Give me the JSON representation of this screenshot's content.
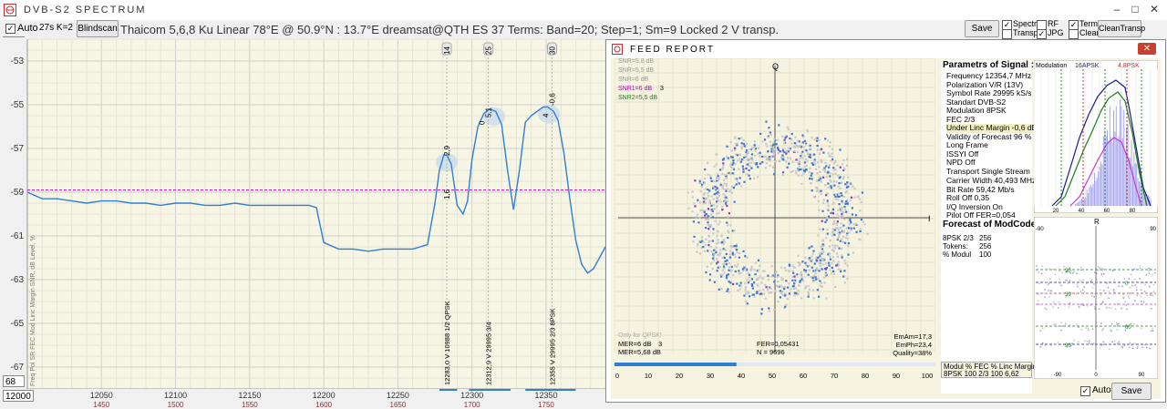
{
  "app": {
    "title": "DVB-S2   SPECTRUM"
  },
  "toolbar": {
    "freq_start": "51",
    "auto_label": "Auto",
    "auto_checked": true,
    "auto_params": "27s K=2",
    "blindscan_label": "Blindscan",
    "sat_info": "Thaicom 5,6,8 Ku Linear   78°E  @  50.9°N : 13.7°E    dreamsat@QTH ES 37     Terms:  Band=20; Step=1; Sm=9    Locked  2 V transp.",
    "save_label": "Save",
    "options": [
      {
        "label": "Spectr",
        "checked": true
      },
      {
        "label": "RF",
        "checked": false
      },
      {
        "label": "Terms",
        "checked": true
      },
      {
        "label": "Transp.",
        "checked": false
      },
      {
        "label": "JPG",
        "checked": true
      },
      {
        "label": "Clean",
        "checked": false
      }
    ],
    "clean_transp_label": "CleanTransp"
  },
  "spectrum": {
    "y_axis_labels": [
      "-53",
      "-55",
      "-57",
      "-59",
      "-61",
      "-63",
      "-65",
      "-67"
    ],
    "left_text": "Freq  Pol  SR  FEC  Mod                    Linc Margin    SNR, dB    Level, %",
    "freq_input": "12000",
    "level_input": "68",
    "x_axis_labels": [
      "12050",
      "12100",
      "12150",
      "12200",
      "12250",
      "12300",
      "12350"
    ],
    "x_axis_sub_labels": [
      "1450",
      "1500",
      "1550",
      "1600",
      "1650",
      "1700",
      "1750"
    ],
    "markers": [
      {
        "num": "14",
        "snr": "2,9",
        "margin": "1,6",
        "label": "12283,0  V  10988  1/2  QPSK"
      },
      {
        "num": "25",
        "snr": "5,1",
        "margin": "0",
        "label": "12312,9  V  29995  3/4"
      },
      {
        "num": "30",
        "snr": "-0,6",
        "margin": "4",
        "label": "12355  V  29995  2/3  8PSK"
      }
    ],
    "chart_data": {
      "type": "line",
      "xlabel": "",
      "ylabel": "",
      "x_range": [
        12000,
        12390
      ],
      "y_range": [
        -68,
        -52
      ],
      "threshold_level": -58.9,
      "x": [
        12000,
        12010,
        12020,
        12030,
        12040,
        12050,
        12060,
        12070,
        12080,
        12090,
        12100,
        12110,
        12120,
        12130,
        12140,
        12150,
        12160,
        12170,
        12180,
        12190,
        12195,
        12200,
        12210,
        12220,
        12230,
        12240,
        12250,
        12260,
        12270,
        12275,
        12278,
        12281,
        12283,
        12286,
        12290,
        12294,
        12297,
        12300,
        12304,
        12308,
        12312,
        12316,
        12320,
        12324,
        12328,
        12332,
        12336,
        12340,
        12344,
        12348,
        12351,
        12355,
        12358,
        12362,
        12366,
        12370,
        12374,
        12378,
        12382,
        12386,
        12390
      ],
      "y": [
        -59.0,
        -59.3,
        -59.3,
        -59.4,
        -59.5,
        -59.4,
        -59.4,
        -59.5,
        -59.5,
        -59.6,
        -59.5,
        -59.5,
        -59.6,
        -59.6,
        -59.5,
        -59.6,
        -59.6,
        -59.6,
        -59.6,
        -59.6,
        -59.7,
        -61.3,
        -61.6,
        -61.6,
        -61.7,
        -61.6,
        -61.6,
        -61.6,
        -61.4,
        -59.5,
        -58.0,
        -57.3,
        -57.3,
        -57.7,
        -59.6,
        -60.0,
        -59.4,
        -57.5,
        -56.0,
        -55.4,
        -55.2,
        -55.3,
        -55.9,
        -58.0,
        -59.8,
        -58.0,
        -55.8,
        -55.5,
        -55.3,
        -55.1,
        -55.1,
        -55.3,
        -55.7,
        -57.2,
        -59.3,
        -61.2,
        -62.3,
        -62.7,
        -62.5,
        -62.0,
        -61.5
      ]
    }
  },
  "feed": {
    "title": "FEED   REPORT",
    "snr_legend": [
      {
        "text": "SNR=5,8 dB",
        "color": "#9a9a9a"
      },
      {
        "text": "SNR=5,5 dB",
        "color": "#9a9a9a"
      },
      {
        "text": "SNR=6 dB",
        "color": "#9a9a9a"
      },
      {
        "text": "SNR1=6 dB",
        "color": "#c000c0"
      },
      {
        "text": "SNR2=5,5 dB",
        "color": "#208020"
      }
    ],
    "snr_legend_count": "3",
    "axis_q": "Q",
    "axis_i": "I",
    "only_for_qpsk": "Only for QPSK!",
    "mer_lines": [
      "MER=6 dB",
      "MER=5,68 dB"
    ],
    "mer_count": "3",
    "fer_lines": [
      "FER=0,05431",
      "N = 9696"
    ],
    "em_lines": [
      "EmAm=17,3",
      "EmPh=23,4",
      "Quality=38%"
    ],
    "bottom_scale": [
      "0",
      "10",
      "20",
      "30",
      "40",
      "50",
      "60",
      "70",
      "80",
      "90",
      "100"
    ],
    "params_title": "Parametrs of Signal :",
    "params": [
      "Frequency  12354,7 MHz",
      "Polarization   V/R (13V)",
      "Symbol Rate  29995 kS/s",
      "Standart  DVB-S2",
      "Modulation   8PSK",
      "FEC  2/3",
      "Under Linc Margin -0,6 dB",
      "Validity of Forecast  96 %",
      "Long  Frame",
      "ISSYI  Off",
      "NPD   Off",
      "Transport Single Stream"
    ],
    "params2": [
      "Carrier Width   40,493 MHz",
      "Bit Rate   59,42 Mb/s",
      "Roll Off   0,35",
      "I/Q Inversion    On",
      "Pilot   Off        FER=0,054"
    ],
    "forecast_title": "Forecast of ModCode",
    "forecast_rows": [
      {
        "k": "8PSK 2/3",
        "v": "256"
      },
      {
        "k": "Tokens:",
        "v": "256"
      },
      {
        "k": "% Modul",
        "v": "100"
      }
    ],
    "table_header": [
      "Modul",
      "%",
      "FEC",
      "%",
      "Linc Margin"
    ],
    "table_row": [
      "8PSK",
      "100",
      "2/3",
      "100",
      "6,62"
    ],
    "modulation_label": "Modulation",
    "mod_16apsk": "16APSK",
    "mod_8psk": "4,8PSK",
    "r_label": "R",
    "r_scale_top": [
      "-90",
      "90"
    ],
    "r_scale_bottom": [
      "-90",
      "0",
      "90"
    ],
    "hist_ticks": [
      "20",
      "40",
      "60",
      "80"
    ],
    "level_marks": [
      "30",
      "0",
      "30",
      "60",
      "90"
    ],
    "auto_label": "Auto",
    "auto_checked": true,
    "save_label": "Save"
  },
  "colors": {
    "accent": "#2f7fd6",
    "threshold": "#c000c0",
    "grid": "#d9d9d9",
    "panel_bg": "#f6f3e0"
  }
}
